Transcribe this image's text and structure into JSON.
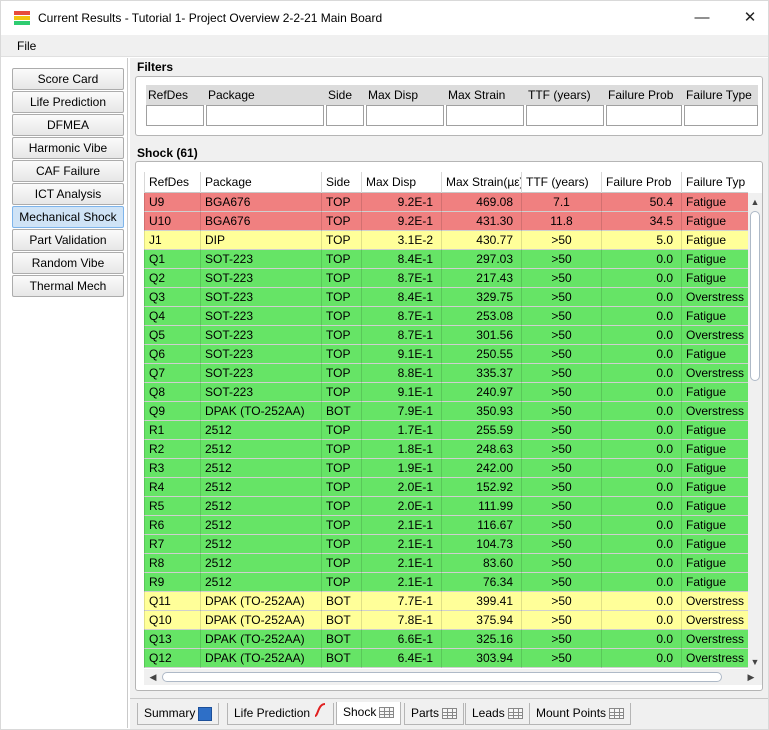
{
  "window": {
    "title": "Current Results - Tutorial 1- Project Overview 2-2-21 Main Board"
  },
  "menu": {
    "file": "File"
  },
  "sidebar": {
    "items": [
      {
        "label": "Score Card",
        "active": false
      },
      {
        "label": "Life Prediction",
        "active": false
      },
      {
        "label": "DFMEA",
        "active": false
      },
      {
        "label": "Harmonic Vibe",
        "active": false
      },
      {
        "label": "CAF Failure",
        "active": false
      },
      {
        "label": "ICT Analysis",
        "active": false
      },
      {
        "label": "Mechanical Shock",
        "active": true
      },
      {
        "label": "Part Validation",
        "active": false
      },
      {
        "label": "Random Vibe",
        "active": false
      },
      {
        "label": "Thermal Mech",
        "active": false
      }
    ]
  },
  "filters": {
    "title": "Filters",
    "columns": [
      "RefDes",
      "Package",
      "Side",
      "Max Disp",
      "Max Strain",
      "TTF (years)",
      "Failure Prob",
      "Failure Type"
    ]
  },
  "grid": {
    "title": "Shock (61)",
    "columns": [
      "RefDes",
      "Package",
      "Side",
      "Max Disp",
      "Max Strain(µε)",
      "TTF (years)",
      "Failure Prob",
      "Failure Typ"
    ],
    "status_colors": {
      "red": "#f08080",
      "yellow": "#ffff99",
      "green": "#66e466"
    },
    "rows": [
      {
        "status": "red",
        "cells": [
          "U9",
          "BGA676",
          "TOP",
          "9.2E-1",
          "469.08",
          "7.1",
          "50.4",
          "Fatigue"
        ]
      },
      {
        "status": "red",
        "cells": [
          "U10",
          "BGA676",
          "TOP",
          "9.2E-1",
          "431.30",
          "11.8",
          "34.5",
          "Fatigue"
        ]
      },
      {
        "status": "yellow",
        "cells": [
          "J1",
          "DIP",
          "TOP",
          "3.1E-2",
          "430.77",
          ">50",
          "5.0",
          "Fatigue"
        ]
      },
      {
        "status": "green",
        "cells": [
          "Q1",
          "SOT-223",
          "TOP",
          "8.4E-1",
          "297.03",
          ">50",
          "0.0",
          "Fatigue"
        ]
      },
      {
        "status": "green",
        "cells": [
          "Q2",
          "SOT-223",
          "TOP",
          "8.7E-1",
          "217.43",
          ">50",
          "0.0",
          "Fatigue"
        ]
      },
      {
        "status": "green",
        "cells": [
          "Q3",
          "SOT-223",
          "TOP",
          "8.4E-1",
          "329.75",
          ">50",
          "0.0",
          "Overstress"
        ]
      },
      {
        "status": "green",
        "cells": [
          "Q4",
          "SOT-223",
          "TOP",
          "8.7E-1",
          "253.08",
          ">50",
          "0.0",
          "Fatigue"
        ]
      },
      {
        "status": "green",
        "cells": [
          "Q5",
          "SOT-223",
          "TOP",
          "8.7E-1",
          "301.56",
          ">50",
          "0.0",
          "Overstress"
        ]
      },
      {
        "status": "green",
        "cells": [
          "Q6",
          "SOT-223",
          "TOP",
          "9.1E-1",
          "250.55",
          ">50",
          "0.0",
          "Fatigue"
        ]
      },
      {
        "status": "green",
        "cells": [
          "Q7",
          "SOT-223",
          "TOP",
          "8.8E-1",
          "335.37",
          ">50",
          "0.0",
          "Overstress"
        ]
      },
      {
        "status": "green",
        "cells": [
          "Q8",
          "SOT-223",
          "TOP",
          "9.1E-1",
          "240.97",
          ">50",
          "0.0",
          "Fatigue"
        ]
      },
      {
        "status": "green",
        "cells": [
          "Q9",
          "DPAK (TO-252AA)",
          "BOT",
          "7.9E-1",
          "350.93",
          ">50",
          "0.0",
          "Overstress"
        ]
      },
      {
        "status": "green",
        "cells": [
          "R1",
          "2512",
          "TOP",
          "1.7E-1",
          "255.59",
          ">50",
          "0.0",
          "Fatigue"
        ]
      },
      {
        "status": "green",
        "cells": [
          "R2",
          "2512",
          "TOP",
          "1.8E-1",
          "248.63",
          ">50",
          "0.0",
          "Fatigue"
        ]
      },
      {
        "status": "green",
        "cells": [
          "R3",
          "2512",
          "TOP",
          "1.9E-1",
          "242.00",
          ">50",
          "0.0",
          "Fatigue"
        ]
      },
      {
        "status": "green",
        "cells": [
          "R4",
          "2512",
          "TOP",
          "2.0E-1",
          "152.92",
          ">50",
          "0.0",
          "Fatigue"
        ]
      },
      {
        "status": "green",
        "cells": [
          "R5",
          "2512",
          "TOP",
          "2.0E-1",
          "111.99",
          ">50",
          "0.0",
          "Fatigue"
        ]
      },
      {
        "status": "green",
        "cells": [
          "R6",
          "2512",
          "TOP",
          "2.1E-1",
          "116.67",
          ">50",
          "0.0",
          "Fatigue"
        ]
      },
      {
        "status": "green",
        "cells": [
          "R7",
          "2512",
          "TOP",
          "2.1E-1",
          "104.73",
          ">50",
          "0.0",
          "Fatigue"
        ]
      },
      {
        "status": "green",
        "cells": [
          "R8",
          "2512",
          "TOP",
          "2.1E-1",
          "83.60",
          ">50",
          "0.0",
          "Fatigue"
        ]
      },
      {
        "status": "green",
        "cells": [
          "R9",
          "2512",
          "TOP",
          "2.1E-1",
          "76.34",
          ">50",
          "0.0",
          "Fatigue"
        ]
      },
      {
        "status": "yellow",
        "cells": [
          "Q11",
          "DPAK (TO-252AA)",
          "BOT",
          "7.7E-1",
          "399.41",
          ">50",
          "0.0",
          "Overstress"
        ]
      },
      {
        "status": "yellow",
        "cells": [
          "Q10",
          "DPAK (TO-252AA)",
          "BOT",
          "7.8E-1",
          "375.94",
          ">50",
          "0.0",
          "Overstress"
        ]
      },
      {
        "status": "green",
        "cells": [
          "Q13",
          "DPAK (TO-252AA)",
          "BOT",
          "6.6E-1",
          "325.16",
          ">50",
          "0.0",
          "Overstress"
        ]
      },
      {
        "status": "green",
        "cells": [
          "Q12",
          "DPAK (TO-252AA)",
          "BOT",
          "6.4E-1",
          "303.94",
          ">50",
          "0.0",
          "Overstress"
        ]
      }
    ]
  },
  "tabs": [
    {
      "label": "Summary",
      "icon": "summary-icon",
      "active": false
    },
    {
      "label": "Life Prediction",
      "icon": "curve-icon",
      "active": false
    },
    {
      "label": "Shock",
      "icon": "grid-icon",
      "active": true
    },
    {
      "label": "Parts",
      "icon": "grid-icon",
      "active": false
    },
    {
      "label": "Leads",
      "icon": "grid-icon",
      "active": false
    },
    {
      "label": "Mount Points",
      "icon": "grid-icon",
      "active": false
    }
  ]
}
